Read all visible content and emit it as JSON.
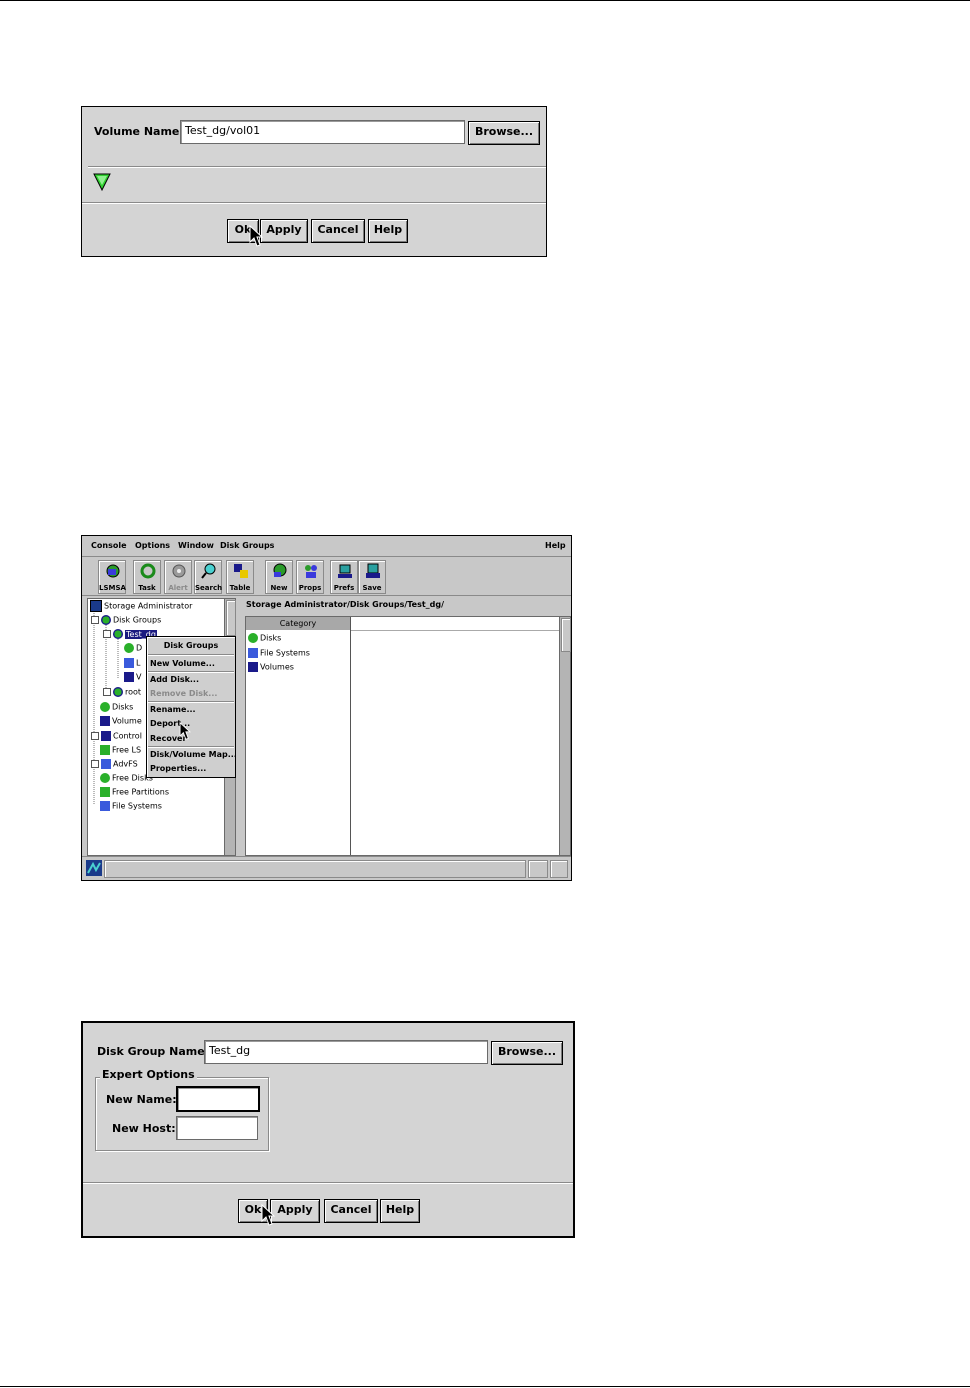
{
  "dialog_volume": {
    "label": "Volume Name:",
    "value": "Test_dg/vol01",
    "browse": "Browse...",
    "ok": "Ok",
    "apply": "Apply",
    "cancel": "Cancel",
    "help": "Help",
    "status_icon": "status-ok-icon"
  },
  "app": {
    "menu": [
      "Console",
      "Options",
      "Window",
      "Disk Groups"
    ],
    "menu_help": "Help",
    "toolbar": [
      {
        "label": "LSMSA",
        "icon": "lsmsa-icon"
      },
      {
        "label": "Task",
        "icon": "task-icon"
      },
      {
        "label": "Alert",
        "icon": "alert-icon"
      },
      {
        "label": "Search",
        "icon": "search-icon"
      },
      {
        "label": "Table",
        "icon": "table-icon"
      },
      {
        "label": "New",
        "icon": "new-icon"
      },
      {
        "label": "Props",
        "icon": "props-icon"
      },
      {
        "label": "Prefs",
        "icon": "prefs-icon"
      },
      {
        "label": "Save",
        "icon": "save-icon"
      }
    ],
    "tree": [
      "Storage Administrator",
      "Disk Groups",
      "Test_dg",
      "D",
      "L",
      "V",
      "root",
      "Disks",
      "Volume",
      "Control",
      "Free LS",
      "AdvFS",
      "Free Disks",
      "Free Partitions",
      "File Systems"
    ],
    "context_menu": {
      "title": "Disk Groups",
      "items": [
        "New Volume...",
        "Add Disk...",
        "Remove Disk...",
        "Rename...",
        "Deport...",
        "Recover",
        "Disk/Volume Map...",
        "Properties..."
      ]
    },
    "path": "Storage Administrator/Disk Groups/Test_dg/",
    "column_header": "Category",
    "categories": [
      "Disks",
      "File Systems",
      "Volumes"
    ]
  },
  "dialog_deport": {
    "dg_label": "Disk Group Name:",
    "dg_value": "Test_dg",
    "browse": "Browse...",
    "expert_title": "Expert Options",
    "new_name_label": "New Name:",
    "new_name_value": "",
    "new_host_label": "New Host:",
    "new_host_value": "",
    "ok": "Ok",
    "apply": "Apply",
    "cancel": "Cancel",
    "help": "Help"
  }
}
